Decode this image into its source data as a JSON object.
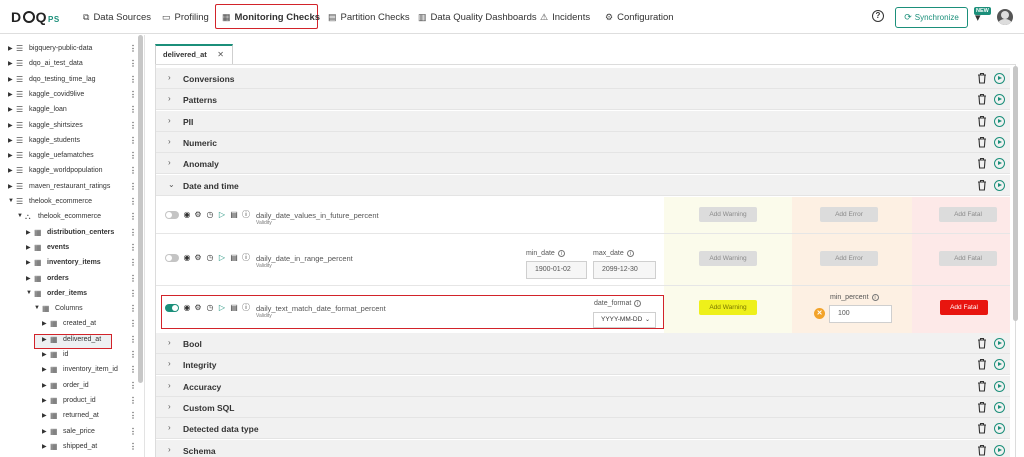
{
  "logo": {
    "main_a": "D",
    "main_b": "Q",
    "suffix": "PS"
  },
  "nav": [
    {
      "label": "Data Sources",
      "icon": "database-icon",
      "glyph": "⧉"
    },
    {
      "label": "Profiling",
      "icon": "document-icon",
      "glyph": "▭"
    },
    {
      "label": "Monitoring Checks",
      "icon": "calendar-icon",
      "glyph": "▦"
    },
    {
      "label": "Partition Checks",
      "icon": "partition-icon",
      "glyph": "▤"
    },
    {
      "label": "Data Quality Dashboards",
      "icon": "dashboard-icon",
      "glyph": "▥"
    },
    {
      "label": "Incidents",
      "icon": "warning-icon",
      "glyph": "⚠"
    },
    {
      "label": "Configuration",
      "icon": "gear-icon",
      "glyph": "⚙"
    }
  ],
  "header": {
    "help": "?",
    "sync_label": "Synchronize",
    "new_badge": "NEW"
  },
  "tree": [
    {
      "label": "bigquery-public-data",
      "level": 0,
      "arrow": "▶",
      "icon": "database-icon",
      "bold": false
    },
    {
      "label": "dqo_ai_test_data",
      "level": 0,
      "arrow": "▶",
      "icon": "database-icon",
      "bold": false
    },
    {
      "label": "dqo_testing_time_lag",
      "level": 0,
      "arrow": "▶",
      "icon": "database-icon",
      "bold": false
    },
    {
      "label": "kaggle_covid9live",
      "level": 0,
      "arrow": "▶",
      "icon": "database-icon",
      "bold": false
    },
    {
      "label": "kaggle_loan",
      "level": 0,
      "arrow": "▶",
      "icon": "database-icon",
      "bold": false
    },
    {
      "label": "kaggle_shirtsizes",
      "level": 0,
      "arrow": "▶",
      "icon": "database-icon",
      "bold": false
    },
    {
      "label": "kaggle_students",
      "level": 0,
      "arrow": "▶",
      "icon": "database-icon",
      "bold": false
    },
    {
      "label": "kaggle_uefamatches",
      "level": 0,
      "arrow": "▶",
      "icon": "database-icon",
      "bold": false
    },
    {
      "label": "kaggle_worldpopulation",
      "level": 0,
      "arrow": "▶",
      "icon": "database-icon",
      "bold": false
    },
    {
      "label": "maven_restaurant_ratings",
      "level": 0,
      "arrow": "▶",
      "icon": "database-icon",
      "bold": false
    },
    {
      "label": "thelook_ecommerce",
      "level": 0,
      "arrow": "▼",
      "icon": "database-icon",
      "bold": false
    },
    {
      "label": "thelook_ecommerce",
      "level": 1,
      "arrow": "▼",
      "icon": "schema-icon",
      "bold": false
    },
    {
      "label": "distribution_centers",
      "level": 2,
      "arrow": "▶",
      "icon": "table-icon",
      "bold": true
    },
    {
      "label": "events",
      "level": 2,
      "arrow": "▶",
      "icon": "table-icon",
      "bold": true
    },
    {
      "label": "inventory_items",
      "level": 2,
      "arrow": "▶",
      "icon": "table-icon",
      "bold": true
    },
    {
      "label": "orders",
      "level": 2,
      "arrow": "▶",
      "icon": "table-icon",
      "bold": true
    },
    {
      "label": "order_items",
      "level": 2,
      "arrow": "▼",
      "icon": "table-icon",
      "bold": true
    },
    {
      "label": "Columns",
      "level": 3,
      "arrow": "▼",
      "icon": "columns-icon",
      "bold": false
    },
    {
      "label": "created_at",
      "level": 4,
      "arrow": "▶",
      "icon": "column-icon",
      "bold": false
    },
    {
      "label": "delivered_at",
      "level": 4,
      "arrow": "▶",
      "icon": "column-icon",
      "bold": false
    },
    {
      "label": "id",
      "level": 4,
      "arrow": "▶",
      "icon": "column-icon",
      "bold": false
    },
    {
      "label": "inventory_item_id",
      "level": 4,
      "arrow": "▶",
      "icon": "column-icon",
      "bold": false
    },
    {
      "label": "order_id",
      "level": 4,
      "arrow": "▶",
      "icon": "column-icon",
      "bold": false
    },
    {
      "label": "product_id",
      "level": 4,
      "arrow": "▶",
      "icon": "column-icon",
      "bold": false
    },
    {
      "label": "returned_at",
      "level": 4,
      "arrow": "▶",
      "icon": "column-icon",
      "bold": false
    },
    {
      "label": "sale_price",
      "level": 4,
      "arrow": "▶",
      "icon": "column-icon",
      "bold": false
    },
    {
      "label": "shipped_at",
      "level": 4,
      "arrow": "▶",
      "icon": "column-icon",
      "bold": false
    }
  ],
  "tab": {
    "label": "delivered_at",
    "close": "✕"
  },
  "categories_top": [
    {
      "name": "Conversions"
    },
    {
      "name": "Patterns"
    },
    {
      "name": "PII"
    },
    {
      "name": "Numeric"
    },
    {
      "name": "Anomaly"
    }
  ],
  "category_open": {
    "name": "Date and time"
  },
  "checks": [
    {
      "name": "daily_date_values_in_future_percent",
      "sub": "Validity",
      "enabled": false,
      "warning_label": "Add Warning",
      "error_label": "Add Error",
      "fatal_label": "Add Fatal"
    },
    {
      "name": "daily_date_in_range_percent",
      "sub": "Validity",
      "enabled": false,
      "min_label": "min_date",
      "min_value": "1900-01-02",
      "max_label": "max_date",
      "max_value": "2099-12-30",
      "warning_label": "Add Warning",
      "error_label": "Add Error",
      "fatal_label": "Add Fatal"
    },
    {
      "name": "daily_text_match_date_format_percent",
      "sub": "Validity",
      "enabled": true,
      "format_label": "date_format",
      "format_value": "YYYY-MM-DD",
      "warning_label": "Add Warning",
      "error_param_label": "min_percent",
      "error_param_value": "100",
      "fatal_label": "Add Fatal"
    }
  ],
  "categories_bottom": [
    {
      "name": "Bool"
    },
    {
      "name": "Integrity"
    },
    {
      "name": "Accuracy"
    },
    {
      "name": "Custom SQL"
    },
    {
      "name": "Detected data type"
    },
    {
      "name": "Schema"
    }
  ],
  "colors": {
    "brand": "#1b8f7a",
    "highlight": "#d2232a",
    "warning_zone": "#fbfbeb",
    "error_zone": "#fdf0e3",
    "fatal_zone": "#fde9e8",
    "warning_button": "#eef01a",
    "fatal_button": "#e8150f"
  }
}
